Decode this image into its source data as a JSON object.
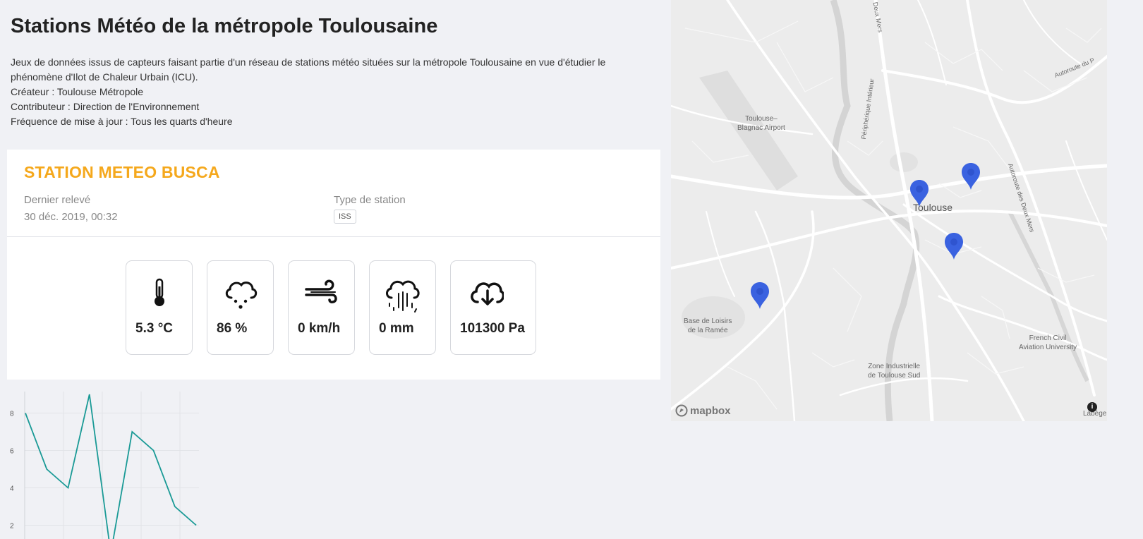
{
  "header": {
    "title": "Stations Météo de la métropole Toulousaine",
    "description": [
      "Jeux de données issus de capteurs faisant partie d'un réseau de stations météo situées sur la métropole Toulousaine en vue d'étudier le phénomène d'Ilot de Chaleur Urbain (ICU).",
      "Créateur : Toulouse Métropole",
      "Contributeur : Direction de l'Environnement",
      "Fréquence de mise à jour : Tous les quarts d'heure"
    ]
  },
  "station": {
    "name": "STATION METEO BUSCA",
    "last_reading_label": "Dernier relevé",
    "last_reading_value": "30 déc. 2019, 00:32",
    "type_label": "Type de station",
    "type_value": "ISS",
    "metrics": [
      {
        "icon": "thermometer-icon",
        "value": "5.3 °C"
      },
      {
        "icon": "humidity-icon",
        "value": "86 %"
      },
      {
        "icon": "wind-icon",
        "value": "0 km/h"
      },
      {
        "icon": "rain-icon",
        "value": "0 mm"
      },
      {
        "icon": "pressure-icon",
        "value": "101300 Pa"
      }
    ]
  },
  "colors": {
    "accent": "#f5a81c",
    "line": "#1a9a96",
    "marker": "#3a62e0"
  },
  "chart_data": {
    "type": "line",
    "x": [
      0,
      1,
      2,
      3,
      4,
      5,
      6,
      7,
      8
    ],
    "values": [
      8,
      5,
      4,
      9,
      0.5,
      7,
      6,
      3,
      2
    ],
    "y_ticks": [
      "2",
      "4",
      "6",
      "8"
    ],
    "ylim": [
      1,
      9
    ],
    "grid": true
  },
  "map": {
    "labels": [
      {
        "name": "airport",
        "text": "Toulouse–\nBlagnac Airport"
      },
      {
        "name": "base-loisirs",
        "text": "Base de Loisirs\nde la Ramée"
      },
      {
        "name": "zone-industrielle",
        "text": "Zone Industrielle\nde Toulouse Sud"
      },
      {
        "name": "aviation-university",
        "text": "French Civil\nAviation University"
      },
      {
        "name": "deux-mers-north",
        "text": "Deux Mers"
      },
      {
        "name": "peripherique",
        "text": "Périphérique Intérieur"
      },
      {
        "name": "autoroute-deux-mers",
        "text": "Autoroute des Deux Mers"
      },
      {
        "name": "autoroute-du",
        "text": "Autoroute du P"
      },
      {
        "name": "labege",
        "text": "Labège"
      }
    ],
    "city": "Toulouse",
    "attribution": "mapbox",
    "info": "i"
  }
}
